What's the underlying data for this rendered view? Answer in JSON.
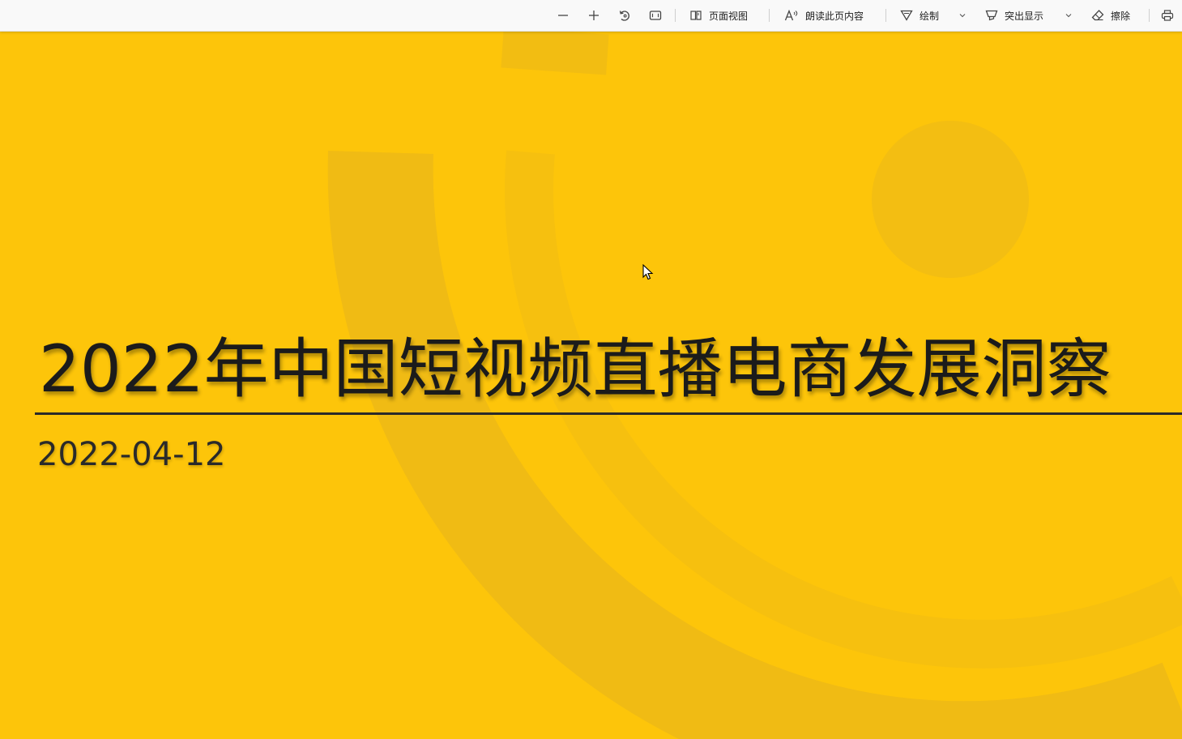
{
  "toolbar": {
    "zoom_out_icon": "minus-icon",
    "zoom_in_icon": "plus-icon",
    "rotate_icon": "rotate-icon",
    "fit_icon": "fit-page-icon",
    "page_view_label": "页面视图",
    "read_aloud_label": "朗读此页内容",
    "draw_label": "绘制",
    "highlight_label": "突出显示",
    "erase_label": "擦除",
    "print_icon": "print-icon"
  },
  "slide": {
    "title": "2022年中国短视频直播电商发展洞察",
    "date": "2022-04-12",
    "background_color": "#fdc50a",
    "text_color": "#1b1b1b"
  }
}
